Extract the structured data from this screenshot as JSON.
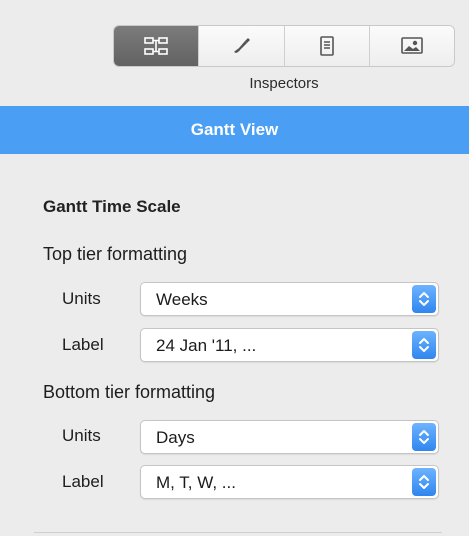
{
  "toolbar": {
    "inspector_label": "Inspectors",
    "buttons": [
      {
        "name": "project-inspector",
        "icon": "inspector-grid-icon",
        "active": true
      },
      {
        "name": "style-inspector",
        "icon": "brush-icon",
        "active": false
      },
      {
        "name": "document-inspector",
        "icon": "document-icon",
        "active": false
      },
      {
        "name": "image-inspector",
        "icon": "image-icon",
        "active": false
      }
    ]
  },
  "header": {
    "title": "Gantt View",
    "color": "#4a9ff5"
  },
  "content": {
    "section_title": "Gantt Time Scale",
    "top_tier": {
      "title": "Top tier formatting",
      "units_label": "Units",
      "units_value": "Weeks",
      "label_label": "Label",
      "label_value": "24 Jan '11, ..."
    },
    "bottom_tier": {
      "title": "Bottom tier formatting",
      "units_label": "Units",
      "units_value": "Days",
      "label_label": "Label",
      "label_value": "M, T, W, ..."
    }
  }
}
